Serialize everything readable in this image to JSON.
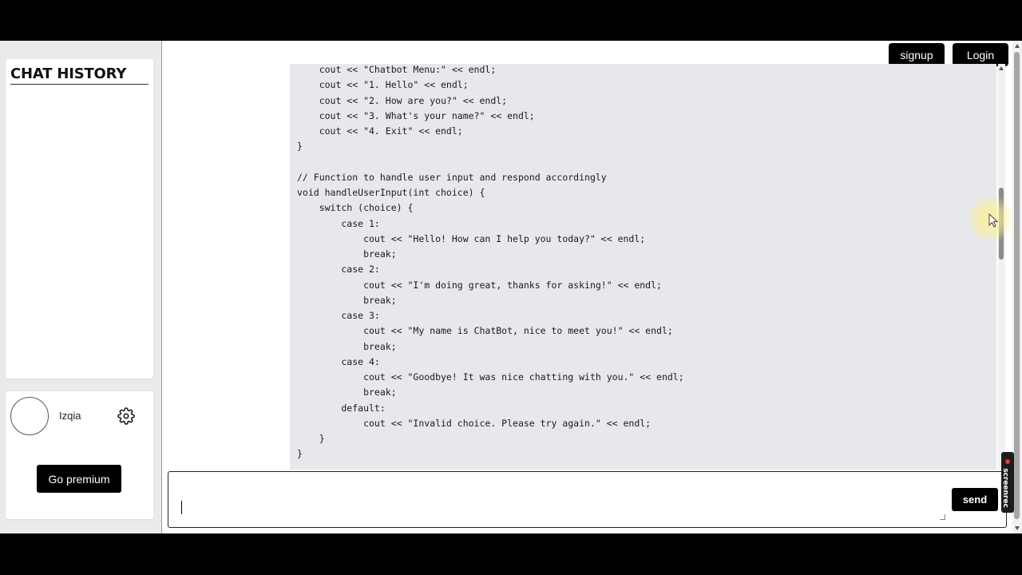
{
  "sidebar": {
    "history_title": "CHAT HISTORY",
    "user": {
      "name": "Izqia",
      "settings_icon": "gear-icon"
    },
    "premium_label": "Go premium"
  },
  "header": {
    "signup_label": "signup",
    "login_label": "Login"
  },
  "chat": {
    "code_lines": [
      "    cout << \"Chatbot Menu:\" << endl;",
      "    cout << \"1. Hello\" << endl;",
      "    cout << \"2. How are you?\" << endl;",
      "    cout << \"3. What's your name?\" << endl;",
      "    cout << \"4. Exit\" << endl;",
      "}",
      "",
      "// Function to handle user input and respond accordingly",
      "void handleUserInput(int choice) {",
      "    switch (choice) {",
      "        case 1:",
      "            cout << \"Hello! How can I help you today?\" << endl;",
      "            break;",
      "        case 2:",
      "            cout << \"I'm doing great, thanks for asking!\" << endl;",
      "            break;",
      "        case 3:",
      "            cout << \"My name is ChatBot, nice to meet you!\" << endl;",
      "            break;",
      "        case 4:",
      "            cout << \"Goodbye! It was nice chatting with you.\" << endl;",
      "            break;",
      "        default:",
      "            cout << \"Invalid choice. Please try again.\" << endl;",
      "    }",
      "}"
    ]
  },
  "composer": {
    "value": "",
    "send_label": "send"
  },
  "watermark": {
    "text": "screenrec"
  }
}
